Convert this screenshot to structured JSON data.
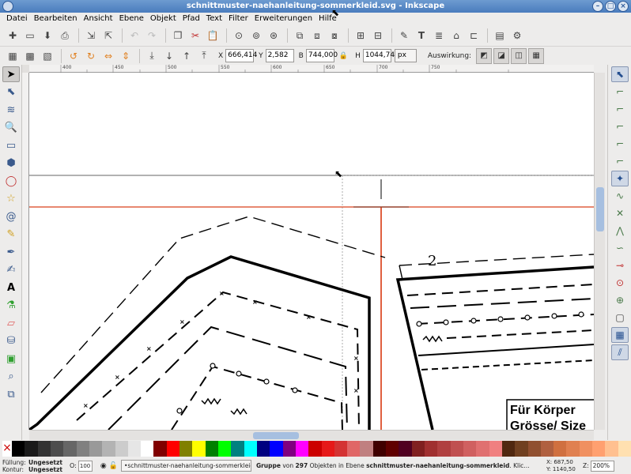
{
  "window": {
    "title": "schnittmuster-naehanleitung-sommerkleid.svg - Inkscape"
  },
  "menu": [
    "Datei",
    "Bearbeiten",
    "Ansicht",
    "Ebene",
    "Objekt",
    "Pfad",
    "Text",
    "Filter",
    "Erweiterungen",
    "Hilfe"
  ],
  "transform": {
    "x_label": "X",
    "x_value": "666,414",
    "y_label": "Y",
    "y_value": "2,582",
    "w_label": "B",
    "w_value": "744,000",
    "h_label": "H",
    "h_value": "1044,74",
    "unit": "px",
    "auswirkung": "Auswirkung:"
  },
  "ruler": {
    "top_labels": [
      "400",
      "450",
      "500",
      "550",
      "600",
      "650",
      "700",
      "750"
    ]
  },
  "canvas_text": {
    "number": "2",
    "heading1": "Für Körper",
    "heading2": "Grösse/ Size"
  },
  "palette": [
    "#000000",
    "#1a1a1a",
    "#333333",
    "#4d4d4d",
    "#666666",
    "#808080",
    "#999999",
    "#b3b3b3",
    "#cccccc",
    "#e6e6e6",
    "#ffffff",
    "#800000",
    "#ff0000",
    "#808000",
    "#ffff00",
    "#008000",
    "#00ff00",
    "#008080",
    "#00ffff",
    "#000080",
    "#0000ff",
    "#800080",
    "#ff00ff",
    "#cc0000",
    "#e61919",
    "#d43333",
    "#e06666",
    "#c08080",
    "#400000",
    "#600000",
    "#500020",
    "#802020",
    "#a03030",
    "#b04040",
    "#c05050",
    "#d06060",
    "#e07070",
    "#f08080",
    "#502810",
    "#704020",
    "#905030",
    "#b06040",
    "#d07040",
    "#e08050",
    "#f09060",
    "#ffa070",
    "#ffc090",
    "#ffe0b0"
  ],
  "status": {
    "fill_label": "Füllung:",
    "fill_value": "Ungesetzt",
    "stroke_label": "Kontur:",
    "stroke_value": "Ungesetzt",
    "opacity_label": "O:",
    "opacity_value": "100",
    "layer": "•schnittmuster-naehanleitung-sommerkleid",
    "msg_prefix": "Gruppe",
    "msg_of": "von",
    "msg_count": "297",
    "msg_mid": "Objekten in Ebene",
    "msg_layer": "schnittmuster-naehanleitung-sommerkleid",
    "msg_suffix": ". Klic…",
    "x_coord": "X:   687,50",
    "y_coord": "Y: 1140,50",
    "zoom_label": "Z:",
    "zoom_value": "200%"
  }
}
